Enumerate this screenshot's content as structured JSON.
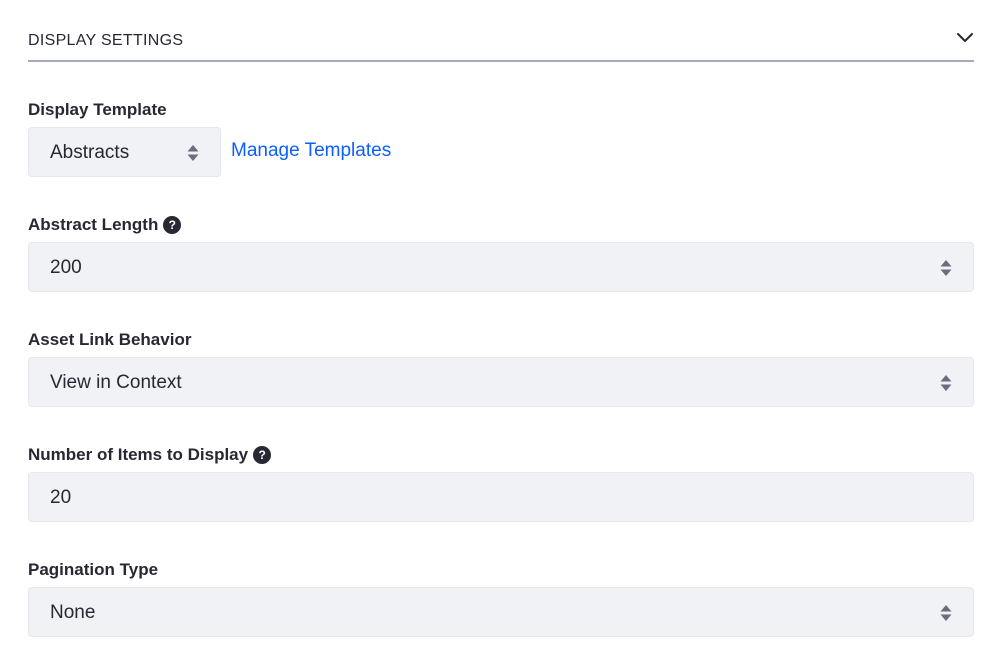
{
  "panel": {
    "title": "DISPLAY SETTINGS",
    "collapse_icon": "chevron-down-icon"
  },
  "display_template": {
    "label": "Display Template",
    "value": "Abstracts",
    "link": "Manage Templates"
  },
  "abstract_length": {
    "label": "Abstract Length",
    "help": "?",
    "value": "200"
  },
  "asset_link_behavior": {
    "label": "Asset Link Behavior",
    "value": "View in Context"
  },
  "items_to_display": {
    "label": "Number of Items to Display",
    "help": "?",
    "value": "20"
  },
  "pagination_type": {
    "label": "Pagination Type",
    "value": "None"
  },
  "colors": {
    "link": "#0b5fff",
    "input_bg": "#f1f2f5",
    "header_border": "#a7a9bc",
    "text": "#272833"
  }
}
